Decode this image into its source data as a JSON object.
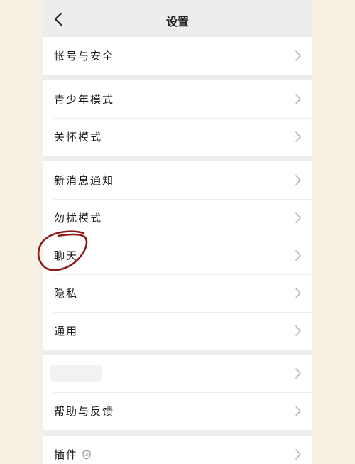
{
  "header": {
    "title": "设置",
    "back_icon": "chevron-left-icon"
  },
  "groups": [
    {
      "items": [
        {
          "label": "帐号与安全"
        }
      ]
    },
    {
      "items": [
        {
          "label": "青少年模式"
        },
        {
          "label": "关怀模式"
        }
      ]
    },
    {
      "items": [
        {
          "label": "新消息通知"
        },
        {
          "label": "勿扰模式"
        },
        {
          "label": "聊天"
        },
        {
          "label": "隐私"
        },
        {
          "label": "通用"
        }
      ]
    },
    {
      "items": [
        {
          "label": ""
        },
        {
          "label": "帮助与反馈"
        }
      ]
    },
    {
      "items": [
        {
          "label": "插件",
          "icon": "shield-icon"
        }
      ]
    }
  ],
  "annotation": {
    "target": "聊天",
    "color": "#8b1a1a"
  },
  "colors": {
    "background": "#f6f1e2",
    "screen": "#ededed",
    "row": "#ffffff",
    "chevron": "#b2b2b2"
  }
}
